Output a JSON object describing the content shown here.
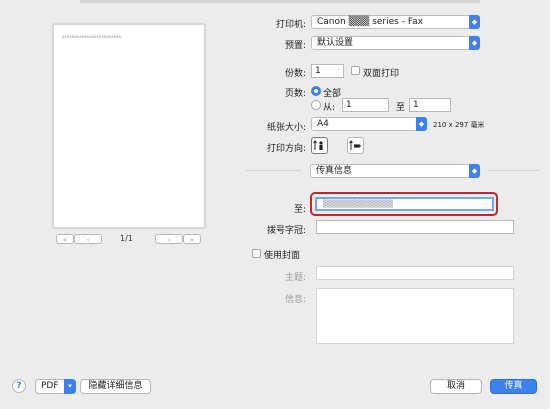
{
  "preview": {
    "text": "xxxxxxxxxxxxxxxxxxxxxxxx",
    "page_indicator": "1/1",
    "first_label": "«",
    "prev_label": "‹",
    "next_label": "›",
    "last_label": "»"
  },
  "printer": {
    "label": "打印机:",
    "value": "Canon ▒▒▒ series - Fax"
  },
  "presets": {
    "label": "预置:",
    "value": "默认设置"
  },
  "copies": {
    "label": "份数:",
    "value": "1",
    "duplex_label": "双面打印"
  },
  "pages": {
    "label": "页数:",
    "all_label": "全部",
    "from_label": "从:",
    "from_value": "1",
    "to_label": "至",
    "to_value": "1"
  },
  "paper": {
    "label": "纸张大小:",
    "value": "A4",
    "size_text": "210 x 297 毫米"
  },
  "orientation": {
    "label": "打印方向:"
  },
  "section": {
    "value": "传真信息"
  },
  "fax": {
    "to_label": "至:",
    "to_value": "▒▒▒▒▒▒▒▒▒▒▒▒▒",
    "prefix_label": "拨号字冠:",
    "prefix_value": "",
    "cover_label": "使用封面",
    "subject_label": "主题:",
    "message_label": "信息:"
  },
  "footer": {
    "help": "?",
    "pdf": "PDF",
    "hide_details": "隐藏详细信息",
    "cancel": "取消",
    "fax": "传真"
  },
  "colors": {
    "accent": "#3b82f0",
    "focus": "#c7252c"
  }
}
